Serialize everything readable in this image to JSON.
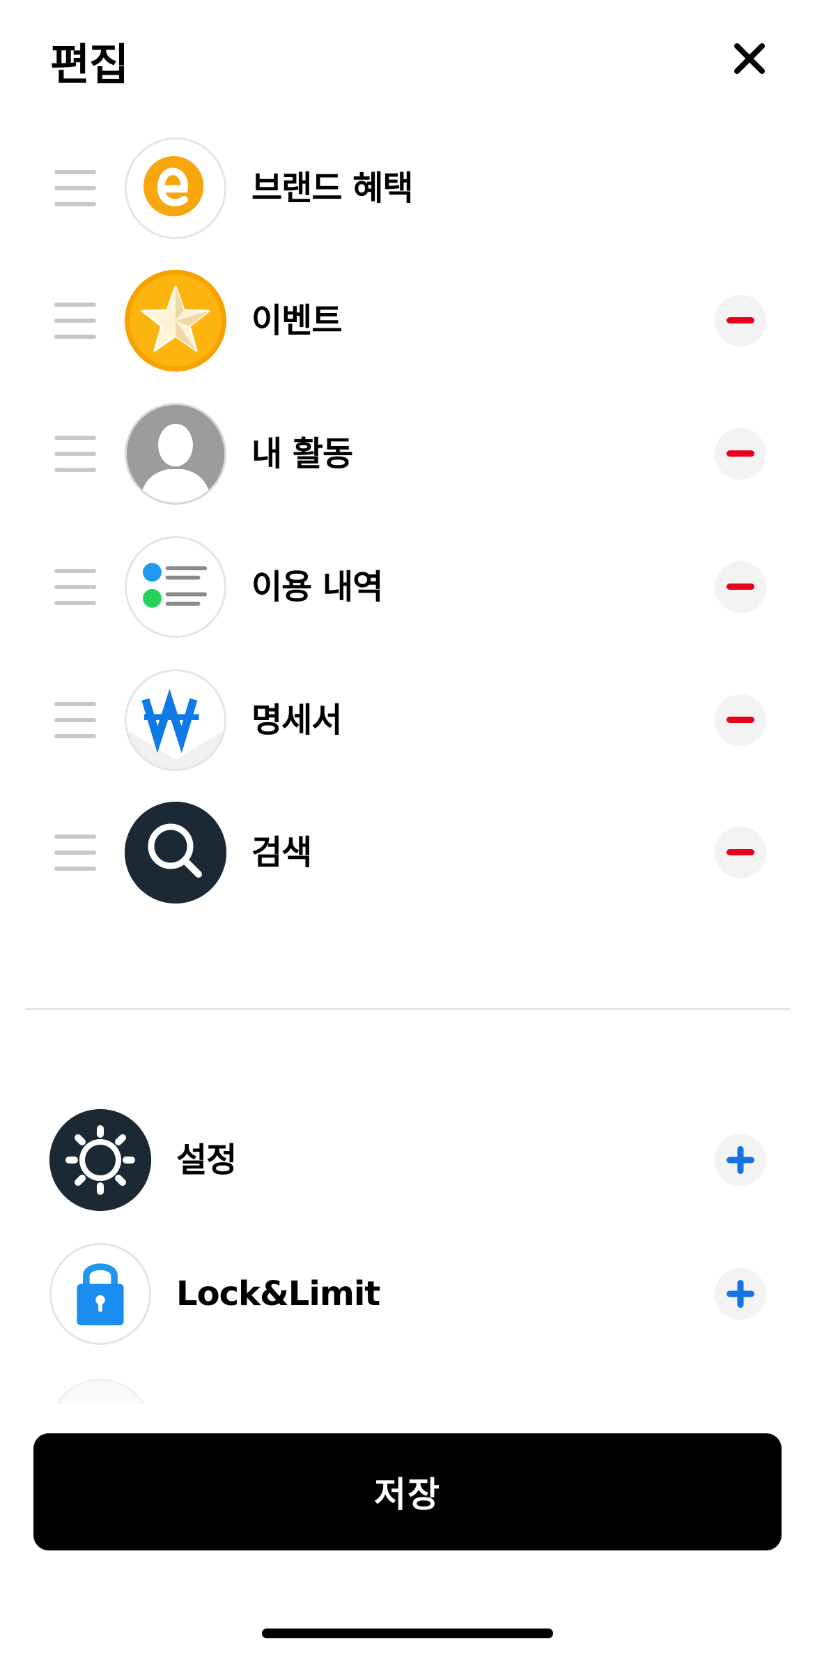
{
  "header": {
    "title": "편집",
    "close_icon": "close-icon"
  },
  "colors": {
    "remove": "#e8001c",
    "add": "#1673e6",
    "save_bg": "#000000",
    "save_text": "#ffffff"
  },
  "active_items": [
    {
      "label": "브랜드 혜택",
      "icon": "brand-benefit-icon",
      "removable": false
    },
    {
      "label": "이벤트",
      "icon": "event-star-icon",
      "removable": true
    },
    {
      "label": "내 활동",
      "icon": "my-activity-icon",
      "removable": true
    },
    {
      "label": "이용 내역",
      "icon": "usage-history-icon",
      "removable": true
    },
    {
      "label": "명세서",
      "icon": "statement-icon",
      "removable": true
    },
    {
      "label": "검색",
      "icon": "search-icon",
      "removable": true
    }
  ],
  "available_items": [
    {
      "label": "설정",
      "icon": "settings-icon"
    },
    {
      "label": "Lock&Limit",
      "icon": "lock-limit-icon"
    }
  ],
  "footer": {
    "save_label": "저장"
  }
}
